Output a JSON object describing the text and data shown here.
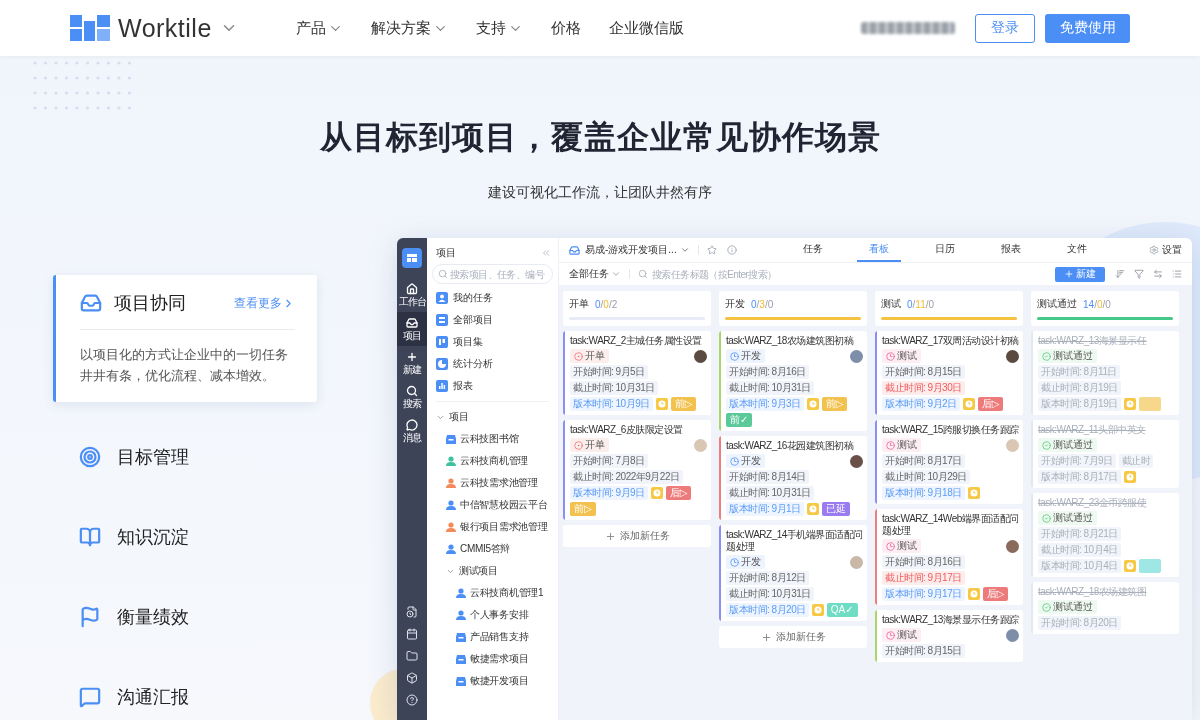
{
  "header": {
    "brand": "Worktile",
    "nav": [
      {
        "label": "产品",
        "has_menu": true
      },
      {
        "label": "解决方案",
        "has_menu": true
      },
      {
        "label": "支持",
        "has_menu": true
      },
      {
        "label": "价格",
        "has_menu": false
      },
      {
        "label": "企业微信版",
        "has_menu": false
      }
    ],
    "login": "登录",
    "signup": "免费使用"
  },
  "hero": {
    "title": "从目标到项目，覆盖企业常见协作场景",
    "subtitle": "建设可视化工作流，让团队井然有序"
  },
  "features": [
    {
      "title": "项目协同",
      "selected": true,
      "link": "查看更多",
      "description": "以项目化的方式让企业中的一切任务井井有条，优化流程、减本增效。"
    },
    {
      "title": "目标管理",
      "selected": false
    },
    {
      "title": "知识沉淀",
      "selected": false
    },
    {
      "title": "衡量绩效",
      "selected": false
    },
    {
      "title": "沟通汇报",
      "selected": false
    }
  ],
  "app": {
    "rail": [
      {
        "label": "工作台",
        "selected": false
      },
      {
        "label": "项目",
        "selected": true
      },
      {
        "label": "新建",
        "selected": false
      },
      {
        "label": "搜索",
        "selected": false
      },
      {
        "label": "消息",
        "selected": false
      }
    ],
    "sidebar": {
      "title": "项目",
      "search_placeholder": "搜索项目、任务、编号",
      "nav": [
        "我的任务",
        "全部项目",
        "项目集",
        "统计分析",
        "报表"
      ],
      "tree": [
        {
          "label": "项目",
          "kind": "group",
          "expanded": true,
          "children": [
            {
              "label": "云科技图书馆",
              "kind": "board",
              "color": "#4b8ef5"
            },
            {
              "label": "云科技商机管理",
              "kind": "member",
              "color": "#3fc1a0"
            },
            {
              "label": "云科技需求池管理",
              "kind": "member",
              "color": "#f5895a"
            },
            {
              "label": "中信智慧校园云平台",
              "kind": "member",
              "color": "#4b8ef5"
            },
            {
              "label": "银行项目需求池管理",
              "kind": "member",
              "color": "#f5895a"
            },
            {
              "label": "CMMI5答辩",
              "kind": "member",
              "color": "#4b8ef5"
            },
            {
              "label": "测试项目",
              "kind": "group",
              "expanded": true,
              "children": [
                {
                  "label": "云科技商机管理1",
                  "kind": "member",
                  "color": "#4b8ef5"
                },
                {
                  "label": "个人事务安排",
                  "kind": "member",
                  "color": "#4b8ef5"
                },
                {
                  "label": "产品销售支持",
                  "kind": "board",
                  "color": "#4b8ef5"
                },
                {
                  "label": "敏捷需求项目",
                  "kind": "board",
                  "color": "#4b8ef5"
                },
                {
                  "label": "敏捷开发项目",
                  "kind": "board",
                  "color": "#4b8ef5"
                }
              ]
            }
          ]
        }
      ]
    },
    "topbar": {
      "project": "易成-游戏开发项目...",
      "tabs": [
        {
          "label": "任务",
          "selected": false
        },
        {
          "label": "看板",
          "selected": true
        },
        {
          "label": "日历",
          "selected": false
        },
        {
          "label": "报表",
          "selected": false
        },
        {
          "label": "文件",
          "selected": false
        }
      ],
      "settings": "设置"
    },
    "toolbar": {
      "filter": "全部任务",
      "search_placeholder": "搜索任务标题（按Enter搜索）",
      "new": "新建"
    },
    "columns": [
      {
        "title": "开单",
        "color": "#e6ebf5",
        "counts": [
          "0",
          "/",
          "0",
          "/",
          "2"
        ],
        "add_label": "添加新任务",
        "cards": [
          {
            "title": "task:WARZ_2主城任务属性设置",
            "done": false,
            "color": "#8b8ff5",
            "status": {
              "kind": "open",
              "label": "开单"
            },
            "chips": [
              {
                "kind": "date",
                "text": "开始时间: 9月5日"
              },
              {
                "kind": "date",
                "text": "截止时间: 10月31日"
              },
              {
                "kind": "version_date",
                "text": "版本时间: 10月9日"
              },
              {
                "kind": "clock"
              },
              {
                "kind": "tag",
                "color": "#f2c14e",
                "text": "前▷"
              }
            ]
          },
          {
            "title": "task:WARZ_6皮肤限定设置",
            "done": false,
            "color": "#8b8ff5",
            "status": {
              "kind": "open",
              "label": "开单"
            },
            "chips": [
              {
                "kind": "date",
                "text": "开始时间: 7月8日"
              },
              {
                "kind": "date",
                "text": "截止时间: 2022年9月22日"
              },
              {
                "kind": "version_date",
                "text": "版本时间: 9月9日"
              },
              {
                "kind": "clock"
              },
              {
                "kind": "tag",
                "color": "#ee7b7b",
                "text": "后▷"
              },
              {
                "kind": "tag",
                "color": "#f2c14e",
                "text": "前▷"
              }
            ]
          }
        ]
      },
      {
        "title": "开发",
        "color": "#f5c342",
        "counts": [
          "0",
          "/",
          "3",
          "/",
          "0"
        ],
        "add_label": "添加新任务",
        "cards": [
          {
            "title": "task:WARZ_18农场建筑图初稿",
            "done": false,
            "color": "#a8d66b",
            "status": {
              "kind": "dev",
              "label": "开发"
            },
            "chips": [
              {
                "kind": "date",
                "text": "开始时间: 8月16日"
              },
              {
                "kind": "date",
                "text": "截止时间: 10月31日"
              },
              {
                "kind": "version_date",
                "text": "版本时间: 9月3日"
              },
              {
                "kind": "clock"
              },
              {
                "kind": "tag",
                "color": "#f2c14e",
                "text": "前▷"
              },
              {
                "kind": "tag",
                "color": "#5cc99b",
                "text": "前✓"
              }
            ]
          },
          {
            "title": "task:WARZ_16花园建筑图初稿",
            "done": false,
            "color": "#ef7d7d",
            "status": {
              "kind": "dev",
              "label": "开发"
            },
            "chips": [
              {
                "kind": "date",
                "text": "开始时间: 8月14日"
              },
              {
                "kind": "date",
                "text": "截止时间: 10月31日"
              },
              {
                "kind": "version_date",
                "text": "版本时间: 9月1日"
              },
              {
                "kind": "clock"
              },
              {
                "kind": "tag",
                "color": "#9b7bf0",
                "text": "已延"
              }
            ]
          },
          {
            "title": "task:WARZ_14手机端界面适配问题处理",
            "done": false,
            "color": "#8b8ff5",
            "status": {
              "kind": "dev",
              "label": "开发"
            },
            "chips": [
              {
                "kind": "date",
                "text": "开始时间: 8月12日"
              },
              {
                "kind": "date",
                "text": "截止时间: 10月31日"
              },
              {
                "kind": "version_date",
                "text": "版本时间: 8月20日"
              },
              {
                "kind": "clock"
              },
              {
                "kind": "tag",
                "color": "#6fdcc4",
                "text": "QA✓"
              }
            ]
          }
        ]
      },
      {
        "title": "测试",
        "color": "#f5c342",
        "counts": [
          "0",
          "/",
          "11",
          "/",
          "0"
        ],
        "cards": [
          {
            "title": "task:WARZ_17双周活动设计初稿",
            "done": false,
            "color": "#8b8ff5",
            "status": {
              "kind": "test",
              "label": "测试"
            },
            "chips": [
              {
                "kind": "date",
                "text": "开始时间: 8月15日"
              },
              {
                "kind": "overdue_date",
                "text": "截止时间: 9月30日"
              },
              {
                "kind": "version_date",
                "text": "版本时间: 9月2日"
              },
              {
                "kind": "clock"
              },
              {
                "kind": "tag",
                "color": "#ee7b7b",
                "text": "后▷"
              }
            ]
          },
          {
            "title": "task:WARZ_15跨服切换任务跟踪",
            "done": false,
            "color": "#8b8ff5",
            "status": {
              "kind": "test",
              "label": "测试"
            },
            "chips": [
              {
                "kind": "date",
                "text": "开始时间: 8月17日"
              },
              {
                "kind": "date",
                "text": "截止时间: 10月29日"
              },
              {
                "kind": "version_date",
                "text": "版本时间: 9月18日"
              },
              {
                "kind": "clock"
              }
            ]
          },
          {
            "title": "task:WARZ_14Web端界面适配问题处理",
            "done": false,
            "color": "#ef7d7d",
            "status": {
              "kind": "test",
              "label": "测试"
            },
            "chips": [
              {
                "kind": "date",
                "text": "开始时间: 8月16日"
              },
              {
                "kind": "overdue_date",
                "text": "截止时间: 9月17日"
              },
              {
                "kind": "version_date",
                "text": "版本时间: 9月17日"
              },
              {
                "kind": "clock"
              },
              {
                "kind": "tag",
                "color": "#ee7b7b",
                "text": "后▷"
              }
            ]
          },
          {
            "title": "task:WARZ_13海景显示任务跟踪",
            "done": false,
            "color": "#a8d66b",
            "status": {
              "kind": "test",
              "label": "测试"
            },
            "chips": [
              {
                "kind": "date",
                "text": "开始时间: 8月15日"
              }
            ]
          }
        ]
      },
      {
        "title": "测试通过",
        "color": "#45c98a",
        "counts": [
          "14",
          "/",
          "0",
          "/",
          "0"
        ],
        "cards": [
          {
            "title": "task:WARZ_13海景显示任",
            "done": true,
            "color": "#e3e7f0",
            "status": {
              "kind": "passed",
              "label": "测试通过"
            },
            "chips": [
              {
                "kind": "date",
                "text": "开始时间: 8月11日"
              },
              {
                "kind": "date",
                "text": "截止时间: 8月19日"
              },
              {
                "kind": "date",
                "text": "版本时间: 8月19日"
              },
              {
                "kind": "clock"
              },
              {
                "kind": "tag",
                "color": "#f7d88a"
              }
            ]
          },
          {
            "title": "task:WARZ_11头部中英文",
            "done": true,
            "color": "#e3e7f0",
            "status": {
              "kind": "passed",
              "label": "测试通过"
            },
            "chips": [
              {
                "kind": "date",
                "text": "开始时间: 7月9日"
              },
              {
                "kind": "date",
                "text": "截止时"
              },
              {
                "kind": "date",
                "text": "版本时间: 8月17日"
              },
              {
                "kind": "clock"
              }
            ]
          },
          {
            "title": "task:WARZ_23金币跨服使",
            "done": true,
            "color": "#e3e7f0",
            "status": {
              "kind": "passed",
              "label": "测试通过"
            },
            "chips": [
              {
                "kind": "date",
                "text": "开始时间: 8月21日"
              },
              {
                "kind": "date",
                "text": "截止时间: 10月4日"
              },
              {
                "kind": "date",
                "text": "版本时间: 10月4日"
              },
              {
                "kind": "clock"
              },
              {
                "kind": "tag",
                "color": "#9ee7e4"
              }
            ]
          },
          {
            "title": "task:WARZ_18农场建筑图",
            "done": true,
            "color": "#e3e7f0",
            "status": {
              "kind": "passed",
              "label": "测试通过"
            },
            "chips": [
              {
                "kind": "date",
                "text": "开始时间: 8月20日"
              }
            ]
          }
        ]
      }
    ]
  }
}
